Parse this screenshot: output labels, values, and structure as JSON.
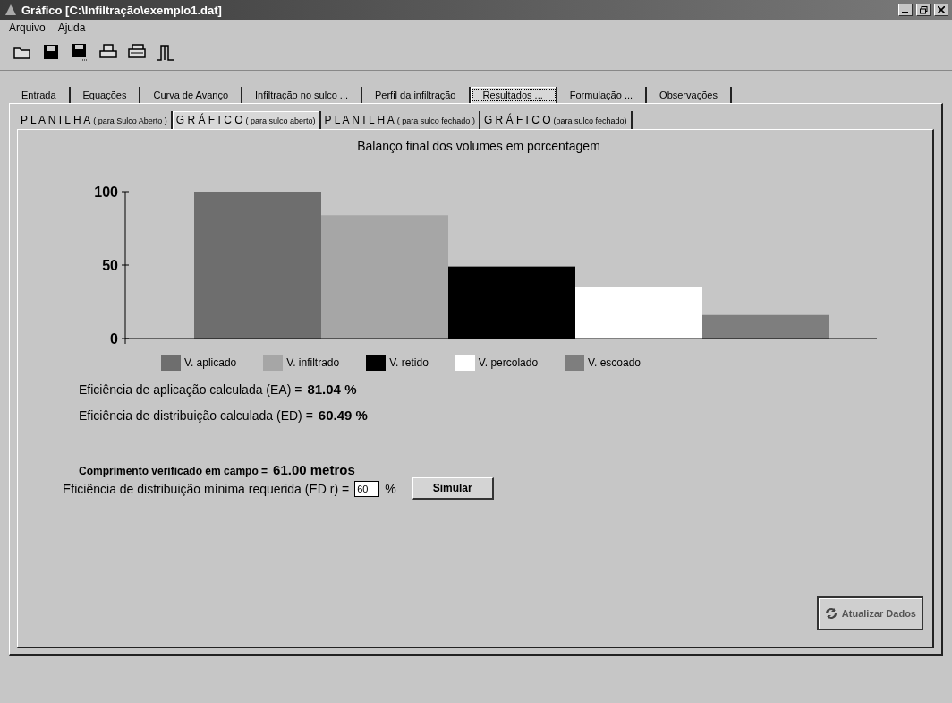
{
  "window": {
    "title": "Gráfico [C:\\Infiltração\\exemplo1.dat]"
  },
  "menu": [
    "Arquivo",
    "Ajuda"
  ],
  "toolbar": [
    {
      "kind": "folder"
    },
    {
      "kind": "disk"
    },
    {
      "kind": "disk-as"
    },
    {
      "kind": "printer"
    },
    {
      "kind": "printer-setup"
    },
    {
      "kind": "exit"
    }
  ],
  "tabs": [
    {
      "label": "Entrada",
      "selected": false
    },
    {
      "label": "Equações",
      "selected": false
    },
    {
      "label": "Curva de Avanço",
      "selected": false
    },
    {
      "label": "Infiltração no sulco ...",
      "selected": false
    },
    {
      "label": "Perfil da infiltração",
      "selected": false
    },
    {
      "label": "Resultados ...",
      "selected": true
    },
    {
      "label": "Formulação ...",
      "selected": false
    },
    {
      "label": "Observações",
      "selected": false
    }
  ],
  "subtabs": [
    {
      "title": "P L A N I L H A",
      "note": "( para Sulco Aberto )",
      "selected": false
    },
    {
      "title": "G R Á F I C O",
      "note": "( para sulco aberto)",
      "selected": true
    },
    {
      "title": "P L A N I L H A",
      "note": "( para sulco fechado )",
      "selected": false
    },
    {
      "title": "G R Á F I C O",
      "note": "(para sulco fechado)",
      "selected": false
    }
  ],
  "chart_data": {
    "type": "bar",
    "title": "Balanço final dos volumes em porcentagem",
    "ylim": [
      0,
      100
    ],
    "yticks": [
      0,
      50,
      100
    ],
    "series": [
      {
        "name": "V. aplicado",
        "color": "#6e6e6e",
        "values": [
          100
        ]
      },
      {
        "name": "V. infiltrado",
        "color": "#a6a6a6",
        "values": [
          84
        ]
      },
      {
        "name": "V. retido",
        "color": "#000000",
        "values": [
          49
        ]
      },
      {
        "name": "V. percolado",
        "color": "#ffffff",
        "values": [
          35
        ]
      },
      {
        "name": "V. escoado",
        "color": "#7e7e7e",
        "values": [
          16
        ]
      }
    ]
  },
  "results": [
    {
      "label": "Eficiência de aplicação calculada (EA) =",
      "value": "81.04 %"
    },
    {
      "label": "Eficiência de distribuição calculada (ED) =",
      "value": "60.49 %"
    }
  ],
  "field_length": {
    "label": "Comprimento verificado em campo =",
    "value": "61.00 metros"
  },
  "min_efficiency": {
    "label": "Eficiência de distribuição mínima requerida (ED r) =",
    "value": "60",
    "unit": "%"
  },
  "buttons": {
    "simulate": "Simular",
    "refresh": "Atualizar Dados"
  }
}
